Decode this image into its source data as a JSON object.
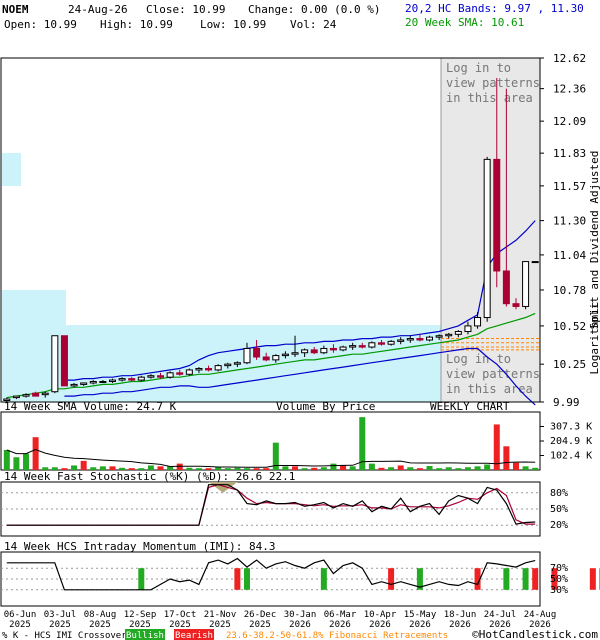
{
  "header": {
    "symbol": "NOEM",
    "date": "24-Aug-26",
    "close": "Close: 10.99",
    "change": "Change: 0.00 (0.0 %)",
    "open": "Open: 10.99",
    "high": "High: 10.99",
    "low": "Low: 10.99",
    "vol": "Vol: 24",
    "bands": "20,2 HC Bands: 9.97 , 11.30",
    "sma": "20 Week SMA: 10.61"
  },
  "colors": {
    "up": "#000000",
    "down": "#aa0033",
    "bands": "#0000cc",
    "sma": "#009900",
    "volume_by_price": "#ccf2fa",
    "bull": "#22aa22",
    "bear": "#ee2222",
    "stoch_k": "#000000",
    "stoch_d": "#aa0033"
  },
  "price_panel": {
    "side_label": "Split and Dividend Adjusted",
    "scale_label": "Logarithmic",
    "overlay_top": [
      "Log in to",
      "view patterns",
      "in this area"
    ],
    "overlay_bottom": [
      "Log in to",
      "view patterns",
      "in this area"
    ],
    "footer_left": "14 Week SMA Volume: 24.7 K",
    "footer_mid": "Volume By Price",
    "footer_right": "WEEKLY CHART"
  },
  "volume_panel": {
    "title": "14 Week SMA Volume: 24.7 K"
  },
  "stoch_panel": {
    "title": "14 Week Fast Stochastic (%K) (%D): 26.6 22.1"
  },
  "imi_panel": {
    "title": "14 Week HCS Intraday Momentum (IMI): 84.3"
  },
  "legend": {
    "text": "% K - HCS IMI Crossover:",
    "bullish": "Bullish",
    "bearish": "Bearish",
    "fib": "23.6-38.2-50-61.8% Fibonacci Retracements",
    "brand": "©HotCandlestick.com"
  },
  "chart_data": {
    "type": "candlestick",
    "y_scale": "log",
    "ylim": [
      9.99,
      12.62
    ],
    "y_ticks": [
      "12.62",
      "12.36",
      "12.09",
      "11.83",
      "11.57",
      "11.30",
      "11.04",
      "10.78",
      "10.52",
      "10.25",
      "9.99"
    ],
    "x_labels": [
      "06-Jun\n2025",
      "03-Jul\n2025",
      "08-Aug\n2025",
      "12-Sep\n2025",
      "17-Oct\n2025",
      "21-Nov\n2025",
      "26-Dec\n2025",
      "30-Jan\n2026",
      "06-Mar\n2026",
      "10-Apr\n2026",
      "15-May\n2026",
      "18-Jun\n2026",
      "24-Jul\n2026",
      "24-Aug\n2026"
    ],
    "candles": [
      [
        10.0,
        10.02,
        9.99,
        10.01
      ],
      [
        10.02,
        10.03,
        10.01,
        10.03
      ],
      [
        10.03,
        10.05,
        10.02,
        10.04
      ],
      [
        10.05,
        10.06,
        10.03,
        10.03
      ],
      [
        10.04,
        10.06,
        10.02,
        10.05
      ],
      [
        10.06,
        10.45,
        10.05,
        10.45
      ],
      [
        10.45,
        10.45,
        10.1,
        10.1
      ],
      [
        10.1,
        10.12,
        10.09,
        10.11
      ],
      [
        10.11,
        10.12,
        10.1,
        10.12
      ],
      [
        10.12,
        10.14,
        10.11,
        10.13
      ],
      [
        10.13,
        10.14,
        10.12,
        10.13
      ],
      [
        10.13,
        10.15,
        10.12,
        10.14
      ],
      [
        10.14,
        10.16,
        10.13,
        10.15
      ],
      [
        10.15,
        10.16,
        10.13,
        10.14
      ],
      [
        10.14,
        10.17,
        10.13,
        10.16
      ],
      [
        10.16,
        10.18,
        10.15,
        10.17
      ],
      [
        10.17,
        10.19,
        10.15,
        10.16
      ],
      [
        10.16,
        10.2,
        10.15,
        10.19
      ],
      [
        10.19,
        10.21,
        10.17,
        10.18
      ],
      [
        10.18,
        10.22,
        10.17,
        10.21
      ],
      [
        10.21,
        10.23,
        10.19,
        10.22
      ],
      [
        10.22,
        10.24,
        10.2,
        10.21
      ],
      [
        10.21,
        10.25,
        10.2,
        10.24
      ],
      [
        10.24,
        10.26,
        10.22,
        10.25
      ],
      [
        10.25,
        10.27,
        10.23,
        10.26
      ],
      [
        10.26,
        10.4,
        10.25,
        10.36
      ],
      [
        10.36,
        10.42,
        10.28,
        10.3
      ],
      [
        10.3,
        10.33,
        10.27,
        10.28
      ],
      [
        10.28,
        10.32,
        10.26,
        10.31
      ],
      [
        10.31,
        10.34,
        10.29,
        10.32
      ],
      [
        10.32,
        10.45,
        10.3,
        10.33
      ],
      [
        10.33,
        10.36,
        10.3,
        10.35
      ],
      [
        10.35,
        10.37,
        10.32,
        10.33
      ],
      [
        10.33,
        10.38,
        10.32,
        10.36
      ],
      [
        10.36,
        10.39,
        10.33,
        10.35
      ],
      [
        10.35,
        10.38,
        10.34,
        10.37
      ],
      [
        10.37,
        10.4,
        10.35,
        10.38
      ],
      [
        10.38,
        10.4,
        10.36,
        10.37
      ],
      [
        10.37,
        10.41,
        10.36,
        10.4
      ],
      [
        10.4,
        10.42,
        10.38,
        10.39
      ],
      [
        10.39,
        10.42,
        10.38,
        10.41
      ],
      [
        10.41,
        10.44,
        10.39,
        10.42
      ],
      [
        10.42,
        10.45,
        10.4,
        10.43
      ],
      [
        10.43,
        10.46,
        10.41,
        10.42
      ],
      [
        10.42,
        10.45,
        10.41,
        10.44
      ],
      [
        10.44,
        10.46,
        10.42,
        10.45
      ],
      [
        10.45,
        10.47,
        10.43,
        10.46
      ],
      [
        10.46,
        10.49,
        10.44,
        10.48
      ],
      [
        10.48,
        10.55,
        10.46,
        10.52
      ],
      [
        10.52,
        10.62,
        10.5,
        10.58
      ],
      [
        10.58,
        11.8,
        10.55,
        11.78
      ],
      [
        11.78,
        12.45,
        10.8,
        10.92
      ],
      [
        10.92,
        12.36,
        10.66,
        10.68
      ],
      [
        10.68,
        10.72,
        10.64,
        10.66
      ],
      [
        10.66,
        10.99,
        10.64,
        10.99
      ],
      [
        10.99,
        10.99,
        10.99,
        10.99
      ]
    ],
    "sma20": [
      10.02,
      10.03,
      10.04,
      10.05,
      10.06,
      10.08,
      10.08,
      10.09,
      10.09,
      10.1,
      10.11,
      10.11,
      10.12,
      10.13,
      10.13,
      10.14,
      10.15,
      10.16,
      10.16,
      10.17,
      10.18,
      10.18,
      10.19,
      10.2,
      10.21,
      10.22,
      10.23,
      10.24,
      10.25,
      10.26,
      10.27,
      10.28,
      10.28,
      10.29,
      10.3,
      10.31,
      10.32,
      10.32,
      10.33,
      10.34,
      10.35,
      10.36,
      10.37,
      10.38,
      10.39,
      10.4,
      10.41,
      10.42,
      10.44,
      10.46,
      10.5,
      10.52,
      10.54,
      10.56,
      10.58,
      10.61
    ],
    "band_upper": [
      null,
      null,
      null,
      null,
      null,
      null,
      10.14,
      10.14,
      10.15,
      10.15,
      10.16,
      10.16,
      10.17,
      10.17,
      10.18,
      10.19,
      10.2,
      10.21,
      10.22,
      10.24,
      10.28,
      10.31,
      10.33,
      10.34,
      10.35,
      10.36,
      10.37,
      10.38,
      10.38,
      10.39,
      10.39,
      10.4,
      10.4,
      10.41,
      10.41,
      10.42,
      10.42,
      10.43,
      10.43,
      10.44,
      10.44,
      10.45,
      10.45,
      10.46,
      10.47,
      10.48,
      10.5,
      10.52,
      10.56,
      10.6,
      10.95,
      11.05,
      11.1,
      11.15,
      11.22,
      11.3
    ],
    "band_lower": [
      null,
      null,
      null,
      null,
      null,
      null,
      10.03,
      10.03,
      10.04,
      10.04,
      10.05,
      10.05,
      10.06,
      10.06,
      10.07,
      10.08,
      10.09,
      10.09,
      10.1,
      10.1,
      10.09,
      10.09,
      10.1,
      10.11,
      10.12,
      10.13,
      10.14,
      10.15,
      10.16,
      10.17,
      10.18,
      10.19,
      10.2,
      10.21,
      10.22,
      10.23,
      10.24,
      10.25,
      10.26,
      10.27,
      10.28,
      10.29,
      10.3,
      10.31,
      10.32,
      10.33,
      10.34,
      10.35,
      10.36,
      10.36,
      10.3,
      10.25,
      10.18,
      10.1,
      10.03,
      9.97
    ],
    "volume_ticks": [
      "307.3 K",
      "204.9 K",
      "102.4 K"
    ],
    "volume_max": 307.3,
    "volume": [
      110,
      70,
      90,
      180,
      15,
      15,
      10,
      25,
      50,
      15,
      20,
      20,
      12,
      10,
      10,
      25,
      20,
      20,
      35,
      12,
      10,
      10,
      15,
      10,
      12,
      10,
      10,
      10,
      150,
      20,
      20,
      10,
      12,
      15,
      35,
      25,
      20,
      290,
      35,
      12,
      15,
      25,
      15,
      10,
      22,
      10,
      15,
      10,
      15,
      20,
      30,
      250,
      130,
      40,
      20,
      12
    ],
    "volume_up": [
      1,
      1,
      1,
      0,
      1,
      1,
      0,
      1,
      0,
      1,
      1,
      0,
      1,
      0,
      1,
      1,
      0,
      1,
      0,
      1,
      1,
      0,
      1,
      1,
      1,
      1,
      0,
      0,
      1,
      1,
      0,
      1,
      0,
      1,
      1,
      0,
      1,
      1,
      1,
      0,
      1,
      0,
      1,
      0,
      1,
      1,
      1,
      1,
      1,
      1,
      1,
      0,
      0,
      0,
      1,
      1
    ],
    "stoch_ticks": [
      "80%",
      "50%",
      "20%"
    ],
    "stoch_k": [
      20,
      20,
      20,
      20,
      20,
      20,
      20,
      20,
      20,
      20,
      20,
      20,
      20,
      20,
      20,
      20,
      20,
      20,
      20,
      20,
      20,
      95,
      95,
      95,
      85,
      60,
      58,
      65,
      60,
      60,
      62,
      55,
      58,
      62,
      52,
      60,
      55,
      65,
      45,
      55,
      50,
      70,
      45,
      55,
      60,
      40,
      65,
      75,
      70,
      60,
      90,
      85,
      60,
      22,
      25,
      26
    ],
    "stoch_d": [
      20,
      20,
      20,
      20,
      20,
      20,
      20,
      20,
      20,
      20,
      20,
      20,
      20,
      20,
      20,
      20,
      20,
      20,
      20,
      20,
      20,
      90,
      95,
      90,
      85,
      70,
      60,
      62,
      60,
      60,
      60,
      58,
      56,
      58,
      55,
      56,
      56,
      58,
      52,
      52,
      50,
      58,
      54,
      54,
      54,
      52,
      56,
      62,
      70,
      68,
      80,
      88,
      75,
      30,
      22,
      22
    ],
    "imi_ticks": [
      "70%",
      "50%",
      "30%"
    ],
    "imi": [
      80,
      80,
      80,
      80,
      80,
      80,
      30,
      30,
      30,
      30,
      30,
      30,
      30,
      30,
      30,
      30,
      40,
      50,
      45,
      48,
      40,
      80,
      85,
      78,
      88,
      72,
      85,
      70,
      78,
      82,
      75,
      70,
      80,
      85,
      60,
      75,
      80,
      70,
      40,
      45,
      40,
      45,
      40,
      35,
      40,
      45,
      40,
      38,
      45,
      40,
      80,
      78,
      75,
      72,
      80,
      84
    ],
    "bullish_signals": [
      14,
      25,
      33,
      43,
      52,
      54
    ],
    "bearish_signals": [
      24,
      40,
      49,
      55,
      57,
      61,
      62,
      64,
      71
    ],
    "fib_levels": [
      10.35,
      10.37,
      10.4,
      10.43
    ]
  }
}
